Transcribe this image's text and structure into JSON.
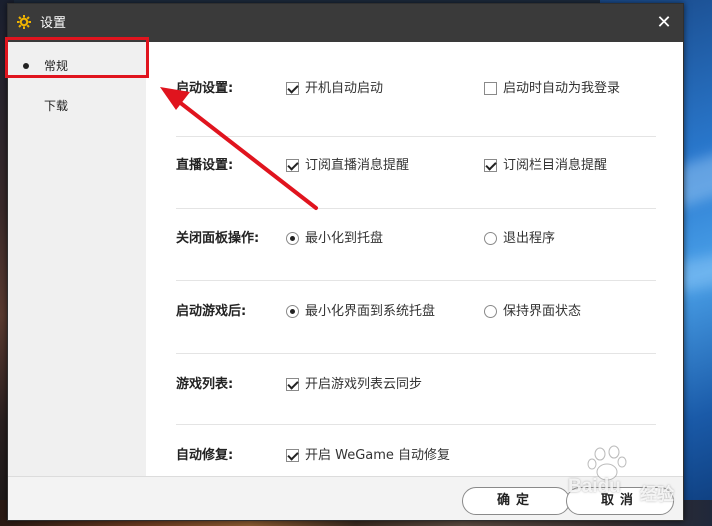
{
  "window": {
    "title": "设置",
    "close_glyph": "✕"
  },
  "sidebar": {
    "items": [
      {
        "label": "常规",
        "selected": true
      },
      {
        "label": "下载",
        "selected": false
      }
    ]
  },
  "settings": {
    "startup": {
      "label": "启动设置:",
      "options": [
        {
          "text": "开机自动启动",
          "checked": true
        },
        {
          "text": "启动时自动为我登录",
          "checked": false
        }
      ]
    },
    "live": {
      "label": "直播设置:",
      "options": [
        {
          "text": "订阅直播消息提醒",
          "checked": true
        },
        {
          "text": "订阅栏目消息提醒",
          "checked": true
        }
      ]
    },
    "close_panel": {
      "label": "关闭面板操作:",
      "options": [
        {
          "text": "最小化到托盘",
          "selected": true
        },
        {
          "text": "退出程序",
          "selected": false
        }
      ]
    },
    "after_game": {
      "label": "启动游戏后:",
      "options": [
        {
          "text": "最小化界面到系统托盘",
          "selected": true
        },
        {
          "text": "保持界面状态",
          "selected": false
        }
      ]
    },
    "game_list": {
      "label": "游戏列表:",
      "options": [
        {
          "text": "开启游戏列表云同步",
          "checked": true
        }
      ]
    },
    "auto_repair": {
      "label": "自动修复:",
      "options": [
        {
          "text": "开启 WeGame 自动修复",
          "checked": true
        }
      ]
    }
  },
  "footer": {
    "ok_label": "确定",
    "cancel_label": "取消"
  },
  "watermark": {
    "brand": "Baidu",
    "suffix": "经验"
  },
  "colors": {
    "titlebar": "#3a3a3a",
    "sidebar": "#f0f0f0",
    "annotation_red": "#e0141e",
    "title_icon": "#f0b400"
  },
  "icons": {
    "title": "gear-icon",
    "close": "close-icon"
  }
}
